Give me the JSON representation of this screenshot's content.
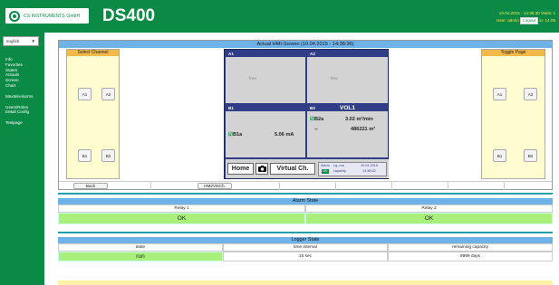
{
  "header": {
    "brand": "CS INSTRUMENTS GmbH",
    "product": "DS400",
    "datetime_line": "10.04.2015 - 14:38:30  Visits: 1",
    "user_prefix": "User: admin",
    "logout": "Logout",
    "session": "in: 14:05"
  },
  "sidebar": {
    "language": "english",
    "items": [
      "Info",
      "Favorites",
      "States",
      "Actuals",
      "Screen",
      "Chart",
      "",
      "MaxMinAlarms",
      "",
      "Users/Roles",
      "EMail Config",
      "",
      "Testpage"
    ]
  },
  "hmi": {
    "title": "Actual HMI-Screen (10.04.2015 - 14:38:36)",
    "left_header": "Select Channel",
    "right_header": "Toggle Page",
    "channel_buttons": [
      "A1",
      "A2",
      "B1",
      "B2"
    ],
    "page_buttons": [
      "A1",
      "A2",
      "B1",
      "B2"
    ],
    "tiles": {
      "a1": {
        "label": "A1",
        "text": "free"
      },
      "a2": {
        "label": "A2",
        "text": "free"
      },
      "b1": {
        "label": "B1",
        "measure_name": "B1a",
        "measure_value": "5.06 mA"
      },
      "b2": {
        "label": "B2",
        "title": "VOL1",
        "line1_name": "B2a",
        "line1_value": "3.02 m³/min",
        "line2_name": "--",
        "line2_value": "486221 m³"
      }
    },
    "home": "Home",
    "virtual": "Virtual Ch.",
    "status": {
      "alarm": "Alarm",
      "alarm_tag": "OK",
      "logrun": "Lg.-run",
      "capacity": "capacity",
      "date": "10.04.2015",
      "time": "13:38:32"
    },
    "back": "Back",
    "hmi_ch": "HMI/VirtCh."
  },
  "alarm": {
    "title": "Alarm State",
    "headers": [
      "Relay 1",
      "Relay 2"
    ],
    "values": [
      "OK",
      "OK"
    ]
  },
  "logger": {
    "title": "Logger State",
    "headers": [
      "state",
      "time interval",
      "remaining capacity"
    ],
    "values": [
      "run",
      "15 sec",
      "9999 days"
    ]
  },
  "colors": {
    "brand_green": "#0b8a46",
    "header_blue": "#6fb2e8",
    "ok_green": "#a8ef7c",
    "accent_orange": "#f0b949"
  }
}
